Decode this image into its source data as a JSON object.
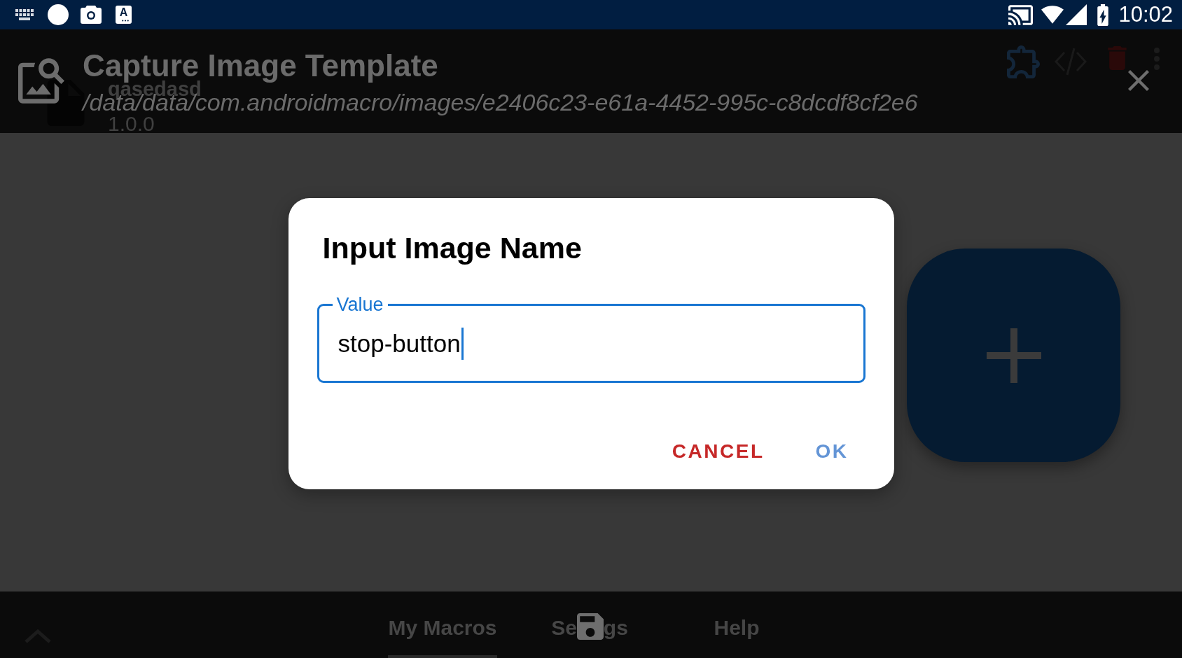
{
  "status_bar": {
    "app_icon_letter": "A",
    "time": "10:02"
  },
  "app_bar": {
    "title": "qasedasd",
    "subtitle": "1.0.0"
  },
  "overlay_header": {
    "title": "Capture Image Template",
    "path": "/data/data/com.androidmacro/images/e2406c23-e61a-4452-995c-c8dcdf8cf2e6"
  },
  "dialog": {
    "title": "Input Image Name",
    "field": {
      "label": "Value",
      "value": "stop-button",
      "focused": true
    },
    "buttons": [
      {
        "label": "CANCEL",
        "kind": "negative"
      },
      {
        "label": "OK",
        "kind": "positive"
      }
    ]
  },
  "bottom_nav": {
    "items": [
      {
        "kind": "plain",
        "label": "My Macros",
        "selected": true
      },
      {
        "kind": "split",
        "label_parts": [
          "Se",
          "gs"
        ],
        "selected": false
      },
      {
        "kind": "plain",
        "label": "Help",
        "selected": false
      }
    ]
  }
}
